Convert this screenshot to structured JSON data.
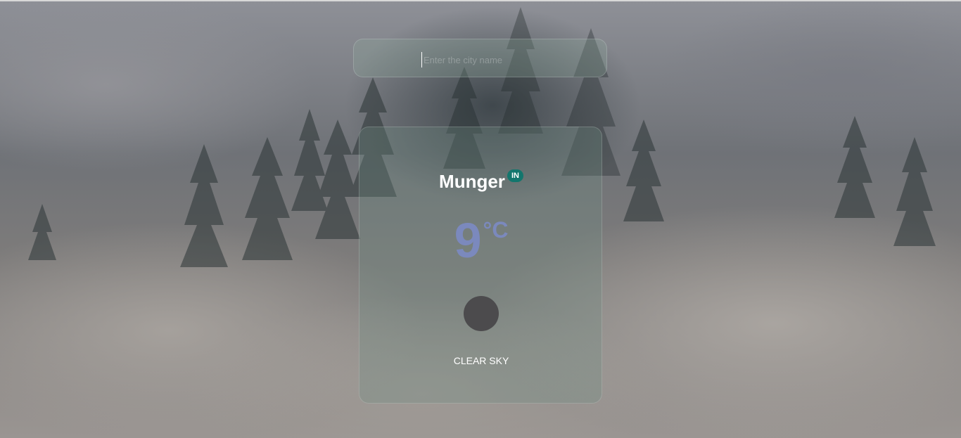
{
  "search": {
    "placeholder": "Enter the city name",
    "value": ""
  },
  "weather": {
    "city": "Munger",
    "country_code": "IN",
    "temperature": "9",
    "unit": "°C",
    "condition": "CLEAR SKY",
    "icon": "weather-icon-placeholder"
  },
  "colors": {
    "temperature": "#7b89bd",
    "country_badge": "#13766d",
    "icon_fill": "#4c4b4d"
  }
}
